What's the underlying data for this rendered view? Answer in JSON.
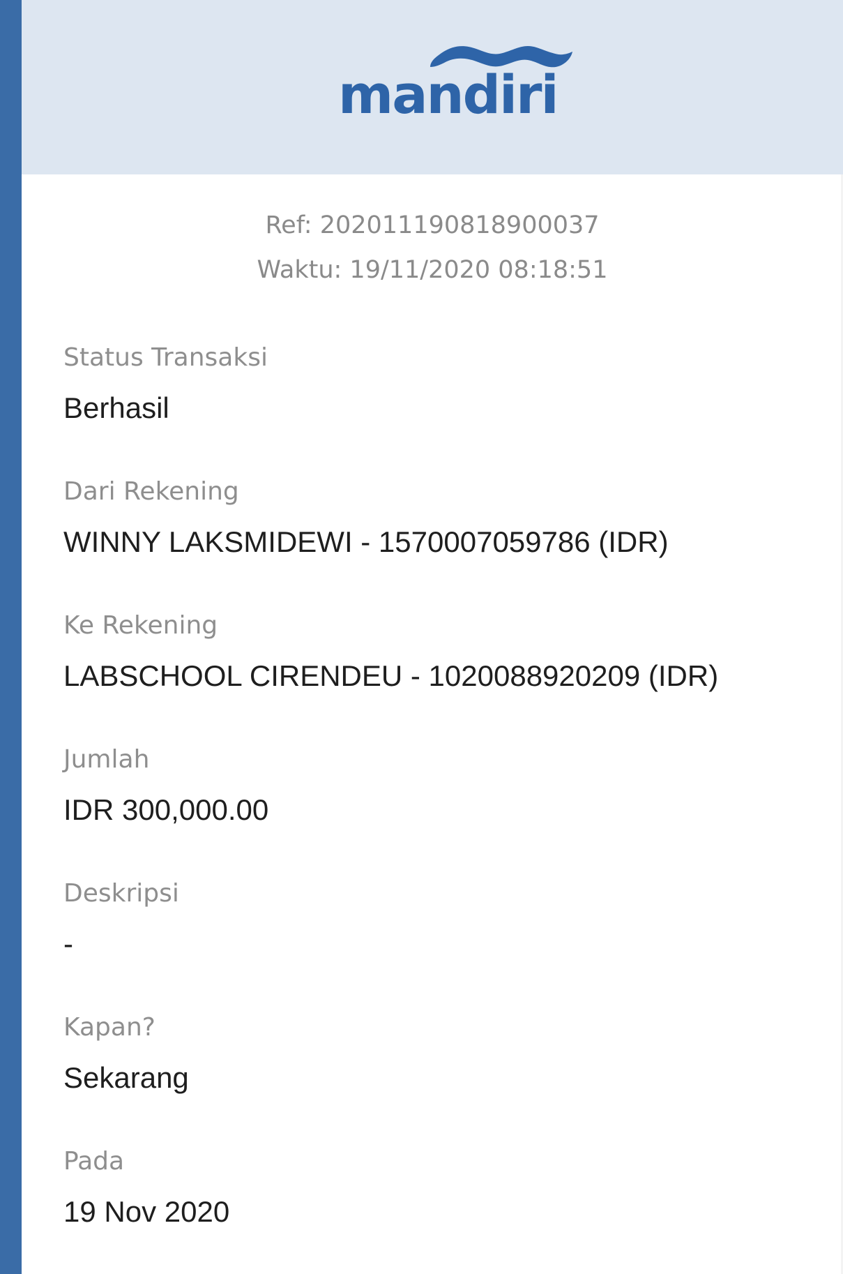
{
  "brand": {
    "logo_text": "mandiri",
    "logo_icon": "mandiri-wave-logo",
    "primary_color": "#2e64a8",
    "stripe_color": "#3a6ca7",
    "header_bg": "#dde6f1"
  },
  "receipt": {
    "ref": "Ref: 202011190818900037",
    "time": "Waktu: 19/11/2020 08:18:51"
  },
  "fields": [
    {
      "label": "Status Transaksi",
      "value": "Berhasil"
    },
    {
      "label": "Dari Rekening",
      "value": "WINNY LAKSMIDEWI - 1570007059786 (IDR)"
    },
    {
      "label": "Ke Rekening",
      "value": "LABSCHOOL CIRENDEU - 1020088920209 (IDR)"
    },
    {
      "label": "Jumlah",
      "value": "IDR 300,000.00"
    },
    {
      "label": "Deskripsi",
      "value": "-"
    },
    {
      "label": "Kapan?",
      "value": "Sekarang"
    },
    {
      "label": "Pada",
      "value": "19 Nov 2020"
    }
  ]
}
